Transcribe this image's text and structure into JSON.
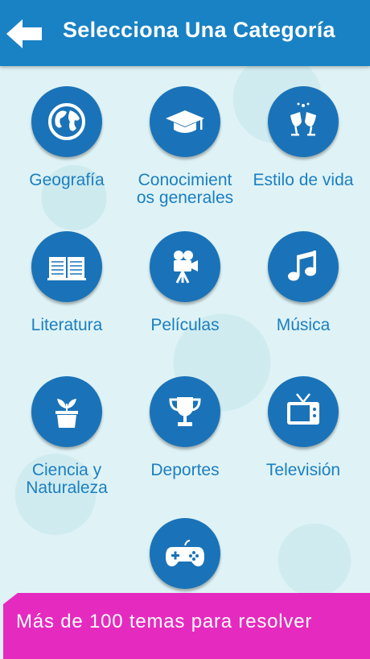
{
  "header": {
    "title": "Selecciona Una Categoría",
    "back_icon": "arrow-left-icon"
  },
  "colors": {
    "header": "#1982c4",
    "circle": "#1a73b8",
    "label": "#1b7fc0",
    "banner": "#e52bbf"
  },
  "categories": [
    {
      "label": "Geografía",
      "icon": "globe-icon"
    },
    {
      "label": "Conocimient\nos generales",
      "icon": "graduation-cap-icon"
    },
    {
      "label": "Estilo de vida",
      "icon": "wine-glasses-icon"
    },
    {
      "label": "Literatura",
      "icon": "book-icon"
    },
    {
      "label": "Películas",
      "icon": "movie-camera-icon"
    },
    {
      "label": "Música",
      "icon": "music-note-icon"
    },
    {
      "label": "Ciencia y\nNaturaleza",
      "icon": "plant-pot-icon"
    },
    {
      "label": "Deportes",
      "icon": "trophy-icon"
    },
    {
      "label": "Televisión",
      "icon": "television-icon"
    },
    {
      "label": "",
      "icon": "gamepad-icon"
    }
  ],
  "banner": {
    "text": "Más de 100 temas para resolver"
  }
}
